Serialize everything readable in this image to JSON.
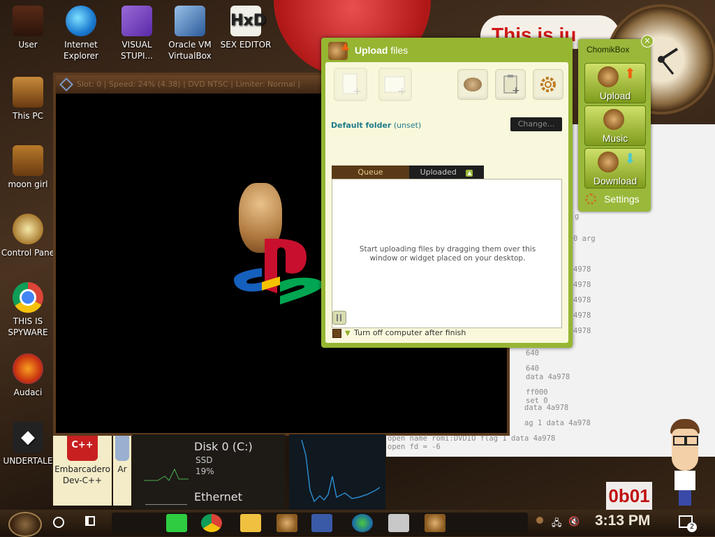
{
  "desktop": {
    "icons": [
      {
        "label": "User"
      },
      {
        "label": "Internet Explorer"
      },
      {
        "label": "VISUAL STUPI..."
      },
      {
        "label": "Oracle VM VirtualBox"
      },
      {
        "label": "SEX EDITOR"
      },
      {
        "label": "This PC"
      },
      {
        "label": "moon girl"
      },
      {
        "label": "Control Pane"
      },
      {
        "label": "THIS IS SPYWARE"
      },
      {
        "label": "Audaci"
      },
      {
        "label": "UNDERTALE"
      },
      {
        "label": "Embarcadero Dev-C++"
      },
      {
        "label": "Ar"
      }
    ],
    "tweet_text": "This is ju",
    "terminal_lines": [
      "g",
      "0 arg",
      "4978",
      "4978",
      "4978",
      "4978",
      "4978",
      "640",
      "640",
      "data 4a978",
      "ff000",
      "set 0",
      "data 4a978",
      "ag 1 data 4a978",
      "open name romi:DVDIO flag 1 data 4a978",
      "open fd = -6"
    ],
    "red_banner": "0b01"
  },
  "video_window": {
    "status": "Slot: 0 | Speed: 24% (4.38) | DVD NTSC | Limiter: Normal |"
  },
  "disk_widget": {
    "title": "Disk 0 (C:)",
    "type": "SSD",
    "usage": "19%",
    "net_title": "Ethernet"
  },
  "upload_window": {
    "title_bold": "Upload",
    "title_rest": " files",
    "folder_label": "Default folder",
    "folder_value": "(unset)",
    "change_button": "Change...",
    "tabs": [
      "Queue",
      "Uploaded"
    ],
    "empty_message": "Start uploading files by dragging them over this window or widget placed on your desktop.",
    "shutdown_label": "Turn off computer after finish"
  },
  "chomikbox": {
    "title": "ChomikBox",
    "close": "×",
    "buttons": [
      "Upload",
      "Music",
      "Download"
    ],
    "settings": "Settings"
  },
  "taskbar": {
    "time": "3:13 PM",
    "notification_count": "2"
  },
  "colors": {
    "upload_green": "#96b632",
    "panel_cream": "#faf8dc",
    "tab_dark": "#5a3a16",
    "folder_text": "#1e7a8a"
  }
}
